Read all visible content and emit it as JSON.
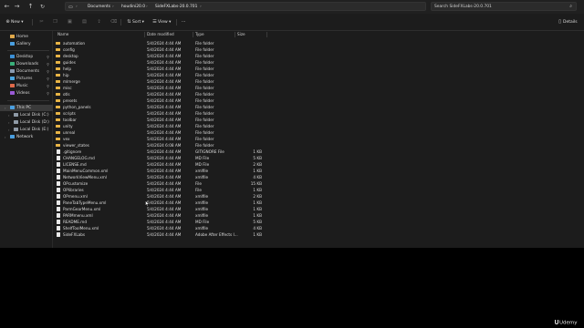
{
  "nav": {
    "breadcrumbs": [
      "Documents",
      "houdini20.0",
      "SideFXLabs-20.0.701"
    ],
    "search_placeholder": "Search SideFXLabs-20.0.701"
  },
  "commands": {
    "new_label": "New",
    "sort_label": "Sort",
    "view_label": "View",
    "more_label": "···",
    "details_label": "Details"
  },
  "sidebar": {
    "quick": [
      {
        "label": "Home",
        "icon": "home-icon",
        "color": "#e0a84a"
      },
      {
        "label": "Gallery",
        "icon": "gallery-icon",
        "color": "#4a9fe0"
      }
    ],
    "pinned": [
      {
        "label": "Desktop",
        "icon": "desktop-icon",
        "color": "#3b8fd6"
      },
      {
        "label": "Downloads",
        "icon": "downloads-icon",
        "color": "#3ab07a"
      },
      {
        "label": "Documents",
        "icon": "documents-icon",
        "color": "#8a9bb0"
      },
      {
        "label": "Pictures",
        "icon": "pictures-icon",
        "color": "#4aa6e0"
      },
      {
        "label": "Music",
        "icon": "music-icon",
        "color": "#e06a4a"
      },
      {
        "label": "Videos",
        "icon": "videos-icon",
        "color": "#9a5ad6"
      }
    ],
    "this_pc": "This PC",
    "drives": [
      "Local Disk (C:)",
      "Local Disk (D:)",
      "Local Disk (E:)"
    ],
    "network": "Network"
  },
  "columns": {
    "name": "Name",
    "date": "Date modified",
    "type": "Type",
    "size": "Size"
  },
  "files": [
    {
      "name": "automation",
      "date": "5/4/2024 4:44 AM",
      "type": "File folder",
      "size": "",
      "kind": "folder"
    },
    {
      "name": "config",
      "date": "5/4/2024 4:44 AM",
      "type": "File folder",
      "size": "",
      "kind": "folder"
    },
    {
      "name": "desktop",
      "date": "5/4/2024 4:44 AM",
      "type": "File folder",
      "size": "",
      "kind": "folder"
    },
    {
      "name": "guides",
      "date": "5/4/2024 4:44 AM",
      "type": "File folder",
      "size": "",
      "kind": "folder"
    },
    {
      "name": "help",
      "date": "5/4/2024 4:44 AM",
      "type": "File folder",
      "size": "",
      "kind": "folder"
    },
    {
      "name": "hip",
      "date": "5/4/2024 4:44 AM",
      "type": "File folder",
      "size": "",
      "kind": "folder"
    },
    {
      "name": "mlmerge",
      "date": "5/4/2024 4:44 AM",
      "type": "File folder",
      "size": "",
      "kind": "folder"
    },
    {
      "name": "misc",
      "date": "5/4/2024 4:44 AM",
      "type": "File folder",
      "size": "",
      "kind": "folder"
    },
    {
      "name": "otls",
      "date": "5/4/2024 4:44 AM",
      "type": "File folder",
      "size": "",
      "kind": "folder"
    },
    {
      "name": "presets",
      "date": "5/4/2024 4:44 AM",
      "type": "File folder",
      "size": "",
      "kind": "folder"
    },
    {
      "name": "python_panels",
      "date": "5/4/2024 4:44 AM",
      "type": "File folder",
      "size": "",
      "kind": "folder"
    },
    {
      "name": "scripts",
      "date": "5/4/2024 4:44 AM",
      "type": "File folder",
      "size": "",
      "kind": "folder"
    },
    {
      "name": "toolbar",
      "date": "5/4/2024 4:44 AM",
      "type": "File folder",
      "size": "",
      "kind": "folder"
    },
    {
      "name": "unity",
      "date": "5/4/2024 4:44 AM",
      "type": "File folder",
      "size": "",
      "kind": "folder"
    },
    {
      "name": "unreal",
      "date": "5/4/2024 4:44 AM",
      "type": "File folder",
      "size": "",
      "kind": "folder"
    },
    {
      "name": "vex",
      "date": "5/4/2024 4:44 AM",
      "type": "File folder",
      "size": "",
      "kind": "folder"
    },
    {
      "name": "viewer_states",
      "date": "5/4/2024 6:08 AM",
      "type": "File folder",
      "size": "",
      "kind": "folder"
    },
    {
      "name": ".gitignore",
      "date": "5/4/2024 4:44 AM",
      "type": "GITIGNORE File",
      "size": "1 KB",
      "kind": "file"
    },
    {
      "name": "CHANGELOG.md",
      "date": "5/4/2024 4:44 AM",
      "type": "MD File",
      "size": "5 KB",
      "kind": "file"
    },
    {
      "name": "LICENSE.md",
      "date": "5/4/2024 4:44 AM",
      "type": "MD File",
      "size": "2 KB",
      "kind": "file"
    },
    {
      "name": "MainMenuCommon.xml",
      "date": "5/4/2024 4:44 AM",
      "type": "xmlfile",
      "size": "1 KB",
      "kind": "file"
    },
    {
      "name": "NetworkViewMenu.xml",
      "date": "5/4/2024 4:44 AM",
      "type": "xmlfile",
      "size": "4 KB",
      "kind": "file"
    },
    {
      "name": "OPcustomize",
      "date": "5/4/2024 4:44 AM",
      "type": "File",
      "size": "15 KB",
      "kind": "file"
    },
    {
      "name": "OPlibraries",
      "date": "5/4/2024 4:44 AM",
      "type": "File",
      "size": "1 KB",
      "kind": "file"
    },
    {
      "name": "OPmenu.xml",
      "date": "5/4/2024 4:44 AM",
      "type": "xmlfile",
      "size": "2 KB",
      "kind": "file"
    },
    {
      "name": "PaneTabTypeMenu.xml",
      "date": "5/4/2024 4:44 AM",
      "type": "xmlfile",
      "size": "1 KB",
      "kind": "file"
    },
    {
      "name": "ParmGearMenu.xml",
      "date": "5/4/2024 4:44 AM",
      "type": "xmlfile",
      "size": "1 KB",
      "kind": "file"
    },
    {
      "name": "PARMmenu.xml",
      "date": "5/4/2024 4:44 AM",
      "type": "xmlfile",
      "size": "1 KB",
      "kind": "file"
    },
    {
      "name": "README.md",
      "date": "5/4/2024 4:44 AM",
      "type": "MD File",
      "size": "5 KB",
      "kind": "file"
    },
    {
      "name": "ShelfToolMenu.xml",
      "date": "5/4/2024 4:44 AM",
      "type": "xmlfile",
      "size": "4 KB",
      "kind": "file"
    },
    {
      "name": "SideFXLabs",
      "date": "5/4/2024 4:44 AM",
      "type": "Adobe After Effects I...",
      "size": "1 KB",
      "kind": "file"
    }
  ],
  "watermark": "Udemy"
}
